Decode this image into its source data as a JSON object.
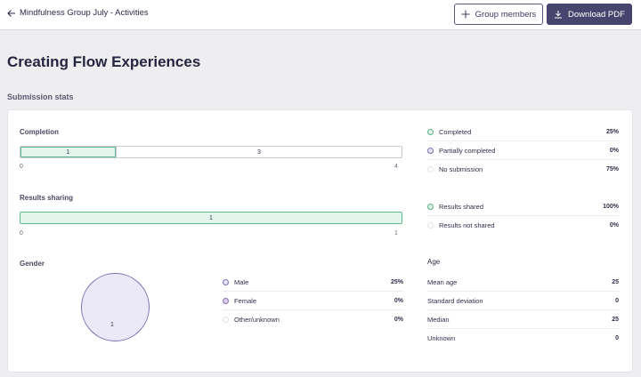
{
  "header": {
    "back_label": "Mindfulness Group July - Activities",
    "group_members_label": "Group members",
    "download_label": "Download PDF"
  },
  "page": {
    "title": "Creating Flow Experiences",
    "section_title": "Submission stats"
  },
  "completion": {
    "label": "Completion",
    "segments": [
      {
        "value": "1",
        "fraction": 0.25
      },
      {
        "value": "3",
        "fraction": 0.75
      }
    ],
    "axis_min": "0",
    "axis_max": "4",
    "legend": [
      {
        "label": "Completed",
        "value": "25%",
        "icon": "green-dot"
      },
      {
        "label": "Partially completed",
        "value": "0%",
        "icon": "purple-dot"
      },
      {
        "label": "No submission",
        "value": "75%",
        "icon": "empty-dot"
      }
    ]
  },
  "sharing": {
    "label": "Results sharing",
    "segments": [
      {
        "value": "1",
        "fraction": 1.0
      }
    ],
    "axis_min": "0",
    "axis_max": "1",
    "legend": [
      {
        "label": "Results shared",
        "value": "100%",
        "icon": "green-dot"
      },
      {
        "label": "Results not shared",
        "value": "0%",
        "icon": "empty-dot"
      }
    ]
  },
  "gender": {
    "label": "Gender",
    "pie_value": "1",
    "legend": [
      {
        "label": "Male",
        "value": "25%",
        "icon": "purple-dot"
      },
      {
        "label": "Female",
        "value": "0%",
        "icon": "purple-dot"
      },
      {
        "label": "Other/unknown",
        "value": "0%",
        "icon": "empty-dot"
      }
    ]
  },
  "age": {
    "label": "Age",
    "rows": [
      {
        "label": "Mean age",
        "value": "25"
      },
      {
        "label": "Standard deviation",
        "value": "0"
      },
      {
        "label": "Median",
        "value": "25"
      },
      {
        "label": "Unknown",
        "value": "0"
      }
    ]
  },
  "colors": {
    "primary": "#47456e",
    "green": "#56b382",
    "purple": "#7a72b5"
  }
}
